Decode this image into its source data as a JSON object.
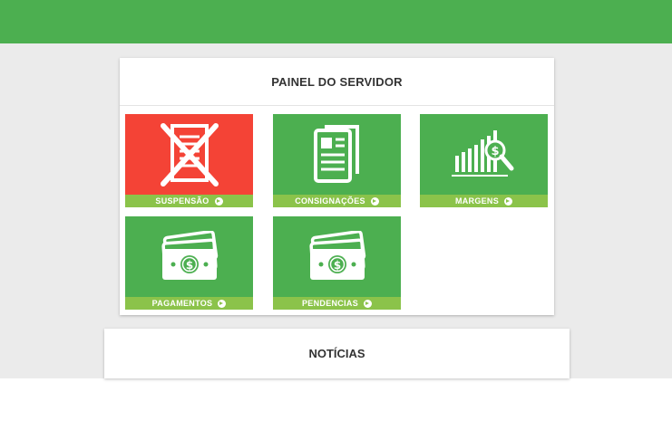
{
  "panel": {
    "title": "PAINEL DO SERVIDOR",
    "tiles": [
      {
        "label": "SUSPENSÃO",
        "icon": "cancelled-document-icon",
        "color": "#f44336"
      },
      {
        "label": "CONSIGNAÇÕES",
        "icon": "documents-icon",
        "color": "#4caf50"
      },
      {
        "label": "MARGENS",
        "icon": "bar-chart-search-icon",
        "color": "#4caf50"
      },
      {
        "label": "PAGAMENTOS",
        "icon": "money-bills-icon",
        "color": "#4caf50"
      },
      {
        "label": "PENDENCIAS",
        "icon": "money-bills-icon",
        "color": "#4caf50"
      }
    ]
  },
  "news": {
    "title": "NOTÍCIAS"
  },
  "colors": {
    "header": "#4caf50",
    "tile_footer": "#8bc34a",
    "background": "#ebebeb"
  }
}
